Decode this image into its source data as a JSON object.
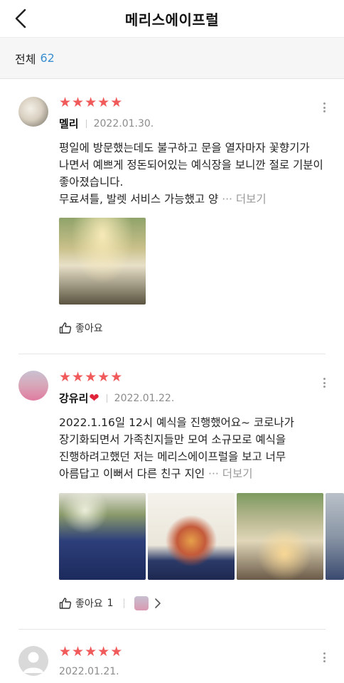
{
  "header": {
    "title": "메리스에이프럴"
  },
  "summary": {
    "label": "전체",
    "count": "62"
  },
  "reviews": [
    {
      "stars": [
        "★",
        "★",
        "★",
        "★",
        "★"
      ],
      "name": "멜리",
      "date": "2022.01.30.",
      "text": "평일에 방문했는데도 불구하고 문을 열자마자 꽃향기가 나면서 예쁘게 정돈되어있는 예식장을 보니깐 절로 기분이 좋아졌습니다.\n무료셔틀, 발렛 서비스 가능했고 양 ",
      "more": "··· 더보기",
      "like_label": "좋아요"
    },
    {
      "stars": [
        "★",
        "★",
        "★",
        "★",
        "★"
      ],
      "name": "강유리",
      "heart": "❤",
      "date": "2022.01.22.",
      "text": "2022.1.16일 12시 예식을 진행했어요~ 코로나가 장기화되면서 가족친지들만 모여 소규모로 예식을 진행하려고했던 저는 메리스에이프럴을 보고 너무 아름답고 이뻐서 다른 친구 지인 ",
      "more": "··· 더보기",
      "like_label": "좋아요",
      "like_count": "1"
    },
    {
      "stars": [
        "★",
        "★",
        "★",
        "★",
        "★"
      ],
      "date": "2022.01.21."
    }
  ]
}
